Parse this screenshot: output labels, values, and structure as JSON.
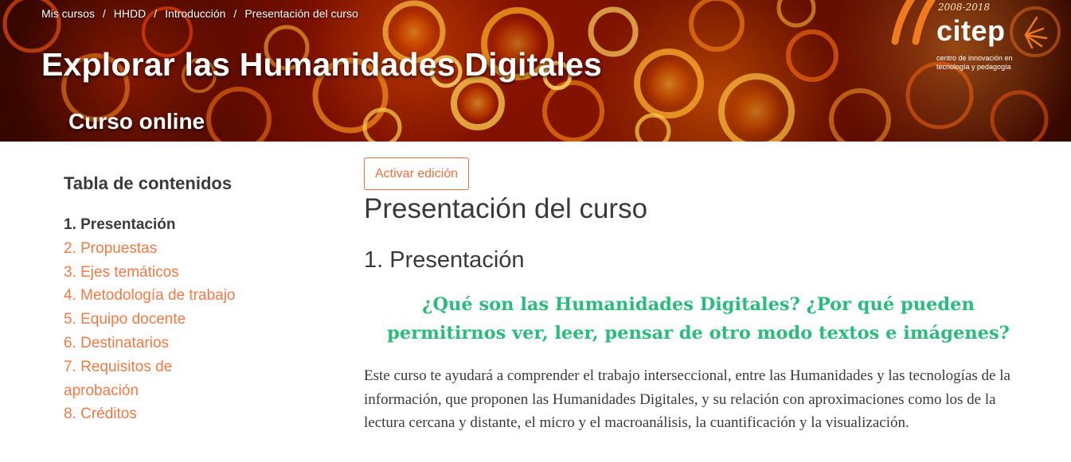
{
  "banner": {
    "breadcrumb": [
      "Mis cursos",
      "HHDD",
      "Introducción",
      "Presentación del curso"
    ],
    "breadcrumb_separator": "/",
    "course_title": "Explorar las Humanidades Digitales",
    "course_subtitle": "Curso online",
    "background_colors": [
      "#2a0500",
      "#ff7a00",
      "#ffd040"
    ]
  },
  "logo": {
    "years": "2008-2018",
    "brand": "citep",
    "tagline_1": "centro de innovación en",
    "tagline_2": "tecnología y pedagogía",
    "accent": "#f07a20"
  },
  "sidebar": {
    "title": "Tabla de contenidos",
    "items": [
      {
        "label": "1. Presentación",
        "current": true
      },
      {
        "label": "2. Propuestas",
        "current": false
      },
      {
        "label": "3. Ejes temáticos",
        "current": false
      },
      {
        "label": "4. Metodología de trabajo",
        "current": false
      },
      {
        "label": "5. Equipo docente",
        "current": false
      },
      {
        "label": "6. Destinatarios",
        "current": false
      },
      {
        "label": "7. Requisitos de aprobación",
        "current": false
      },
      {
        "label": "8. Créditos",
        "current": false
      }
    ]
  },
  "main": {
    "edit_button": "Activar edición",
    "page_title": "Presentación del curso",
    "section_title": "1. Presentación",
    "question": "¿Qué son las Humanidades Digitales? ¿Por qué pueden permitirnos ver, leer, pensar de otro modo textos e imágenes?",
    "paragraph": "Este curso te ayudará a comprender el trabajo interseccional, entre las Humanidades y las tecnologías de la información, que proponen las Humanidades Digitales, y su relación con aproximaciones como los de la lectura cercana y distante, el micro y el macroanálisis, la cuantificación y la visualización."
  },
  "colors": {
    "link": "#f07a45",
    "accent_button": "#e8703c",
    "question_green": "#2bbb7b",
    "text": "#3a3a3a"
  }
}
